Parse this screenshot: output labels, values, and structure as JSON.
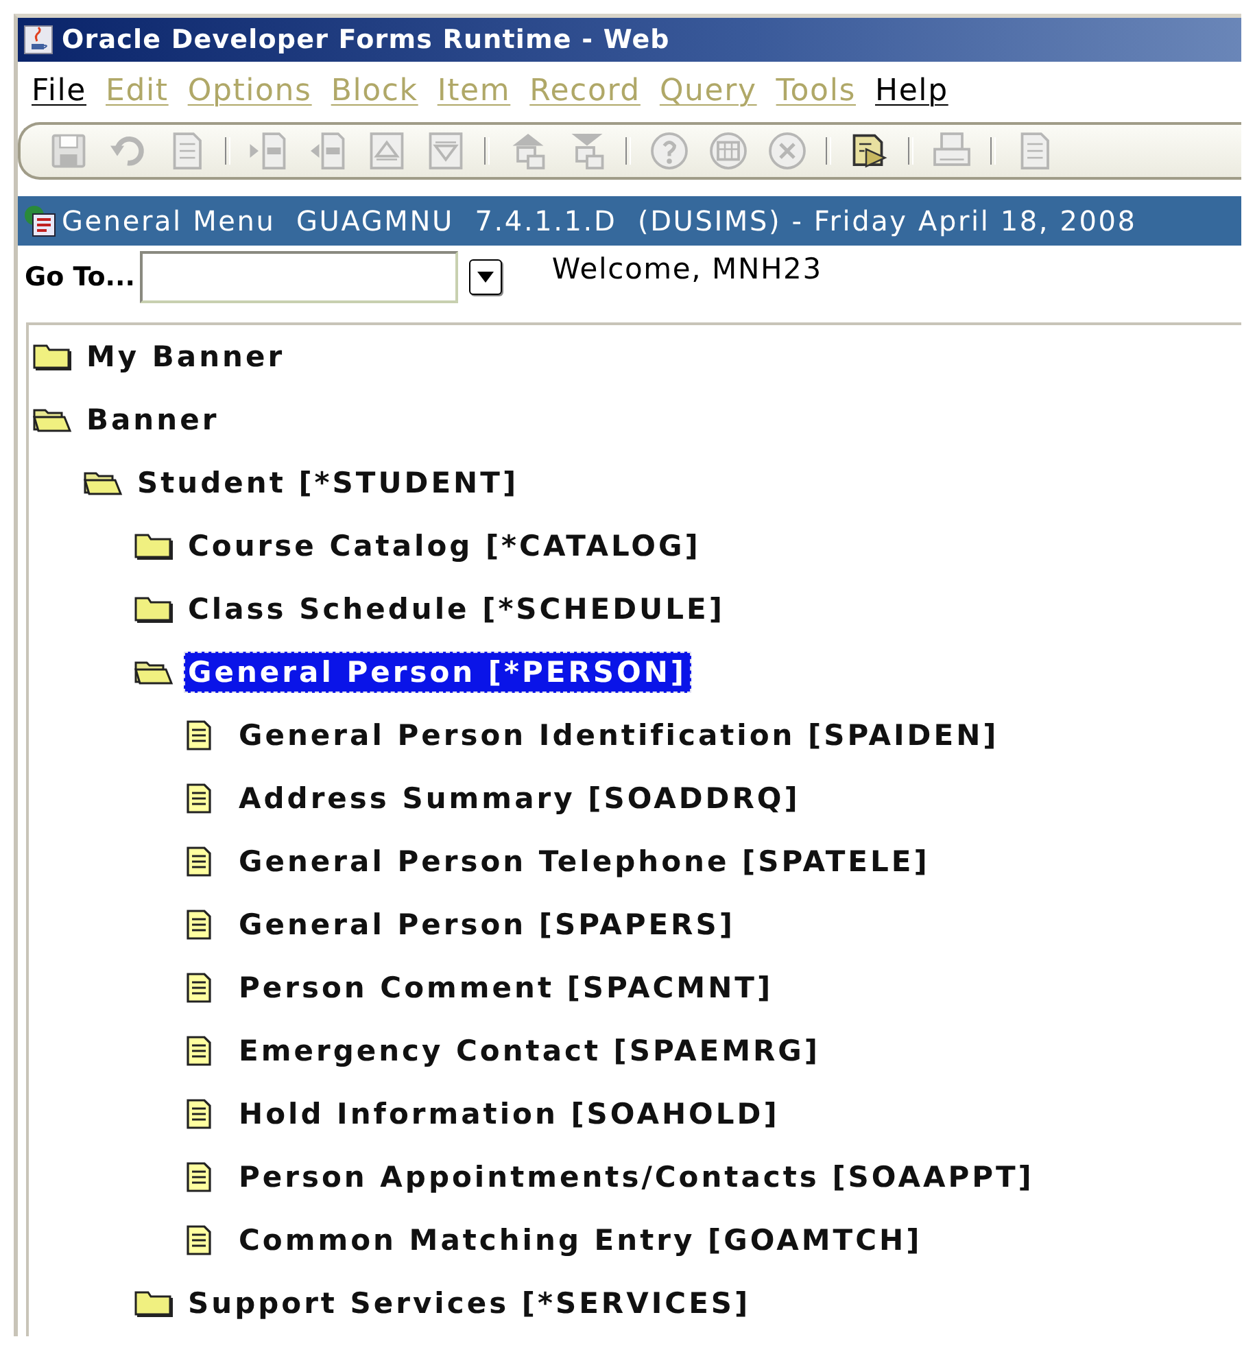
{
  "window": {
    "title": "Oracle Developer Forms Runtime - Web"
  },
  "menu": [
    {
      "label": "File",
      "disabled": false
    },
    {
      "label": "Edit",
      "disabled": true
    },
    {
      "label": "Options",
      "disabled": true
    },
    {
      "label": "Block",
      "disabled": true
    },
    {
      "label": "Item",
      "disabled": true
    },
    {
      "label": "Record",
      "disabled": true
    },
    {
      "label": "Query",
      "disabled": true
    },
    {
      "label": "Tools",
      "disabled": true
    },
    {
      "label": "Help",
      "disabled": false
    }
  ],
  "toolbar": [
    {
      "kind": "save",
      "disabled": true
    },
    {
      "kind": "undo",
      "disabled": true
    },
    {
      "kind": "page",
      "disabled": true
    },
    {
      "kind": "separator"
    },
    {
      "kind": "next",
      "disabled": true
    },
    {
      "kind": "prev",
      "disabled": true
    },
    {
      "kind": "first",
      "disabled": true
    },
    {
      "kind": "last",
      "disabled": true
    },
    {
      "kind": "separator"
    },
    {
      "kind": "up",
      "disabled": true
    },
    {
      "kind": "down",
      "disabled": true
    },
    {
      "kind": "separator"
    },
    {
      "kind": "help",
      "disabled": true
    },
    {
      "kind": "grid",
      "disabled": true
    },
    {
      "kind": "cancel",
      "disabled": true
    },
    {
      "kind": "separator"
    },
    {
      "kind": "edit",
      "disabled": false
    },
    {
      "kind": "separator"
    },
    {
      "kind": "print",
      "disabled": true
    },
    {
      "kind": "separator"
    },
    {
      "kind": "page",
      "disabled": true
    }
  ],
  "form": {
    "title": "General Menu  GUAGMNU  7.4.1.1.D  (DUSIMS) - Friday April 18, 2008",
    "goto_label": "Go To...",
    "welcome": "Welcome, MNH23"
  },
  "tree": [
    {
      "kind": "folder",
      "label": "My Banner",
      "expanded": false,
      "selected": false
    },
    {
      "kind": "folder",
      "label": "Banner",
      "expanded": true,
      "selected": false,
      "children": [
        {
          "kind": "folder",
          "label": "Student [*STUDENT]",
          "expanded": true,
          "selected": false,
          "children": [
            {
              "kind": "folder",
              "label": "Course Catalog [*CATALOG]",
              "expanded": false,
              "selected": false
            },
            {
              "kind": "folder",
              "label": "Class Schedule [*SCHEDULE]",
              "expanded": false,
              "selected": false
            },
            {
              "kind": "folder",
              "label": "General Person [*PERSON]",
              "expanded": true,
              "selected": true,
              "children": [
                {
                  "kind": "form",
                  "label": "General Person Identification [SPAIDEN]",
                  "selected": false
                },
                {
                  "kind": "form",
                  "label": "Address Summary [SOADDRQ]",
                  "selected": false
                },
                {
                  "kind": "form",
                  "label": "General Person Telephone [SPATELE]",
                  "selected": false
                },
                {
                  "kind": "form",
                  "label": "General Person [SPAPERS]",
                  "selected": false
                },
                {
                  "kind": "form",
                  "label": "Person Comment [SPACMNT]",
                  "selected": false
                },
                {
                  "kind": "form",
                  "label": "Emergency Contact [SPAEMRG]",
                  "selected": false
                },
                {
                  "kind": "form",
                  "label": "Hold Information [SOAHOLD]",
                  "selected": false
                },
                {
                  "kind": "form",
                  "label": "Person Appointments/Contacts [SOAAPPT]",
                  "selected": false
                },
                {
                  "kind": "form",
                  "label": "Common Matching Entry [GOAMTCH]",
                  "selected": false
                }
              ]
            },
            {
              "kind": "folder",
              "label": "Support Services [*SERVICES]",
              "expanded": false,
              "selected": false
            }
          ]
        }
      ]
    }
  ]
}
